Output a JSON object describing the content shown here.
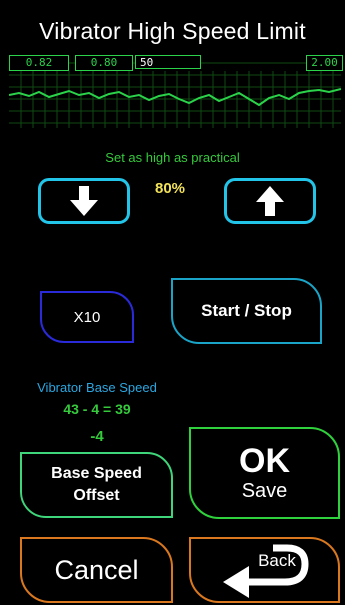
{
  "screen": {
    "title": "Vibrator High Speed Limit"
  },
  "trace": {
    "readouts": [
      "0.82",
      "0.80",
      "50",
      "2.00"
    ],
    "color": "#2bd34a"
  },
  "speed_limit": {
    "hint": "Set as high as practical",
    "value": "80%",
    "down_icon": "arrow-down-icon",
    "up_icon": "arrow-up-icon"
  },
  "controls": {
    "x10_label": "X10",
    "start_stop_label": "Start / Stop"
  },
  "base_speed": {
    "label": "Vibrator Base Speed",
    "equation": "43 - 4 = 39",
    "offset": "-4",
    "offset_button_line1": "Base Speed",
    "offset_button_line2": "Offset"
  },
  "actions": {
    "ok_label": "OK",
    "save_label": "Save",
    "cancel_label": "Cancel",
    "back_label": "Back"
  }
}
